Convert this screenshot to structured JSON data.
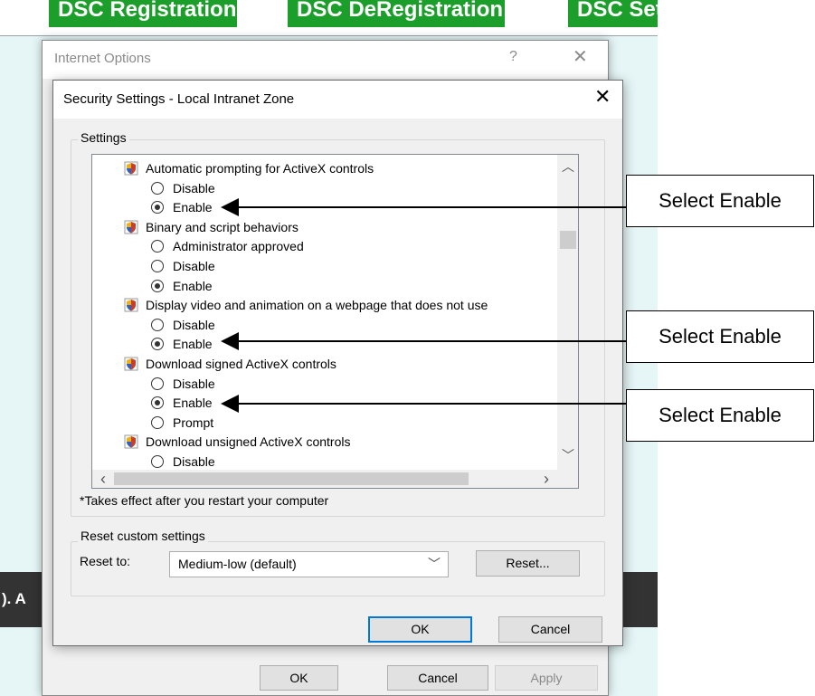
{
  "web_page": {
    "buttons": [
      "DSC Registration",
      "DSC DeRegistration",
      "DSC Set"
    ],
    "dark_bar_text": "). A"
  },
  "internet_options": {
    "title": "Internet Options",
    "help_glyph": "?",
    "close_glyph": "✕",
    "ok": "OK",
    "cancel": "Cancel",
    "apply": "Apply"
  },
  "dialog": {
    "title": "Security Settings - Local Intranet Zone",
    "close_glyph": "✕",
    "settings_group_label": "Settings",
    "settings": [
      {
        "kind": "category",
        "label": "Automatic prompting for ActiveX controls",
        "icon": "settings-shield-icon"
      },
      {
        "kind": "option",
        "label": "Disable",
        "checked": false
      },
      {
        "kind": "option",
        "label": "Enable",
        "checked": true
      },
      {
        "kind": "category",
        "label": "Binary and script behaviors",
        "icon": "settings-shield-icon"
      },
      {
        "kind": "option",
        "label": "Administrator approved",
        "checked": false
      },
      {
        "kind": "option",
        "label": "Disable",
        "checked": false
      },
      {
        "kind": "option",
        "label": "Enable",
        "checked": true
      },
      {
        "kind": "category",
        "label": "Display video and animation on a webpage that does not use",
        "icon": "settings-shield-icon"
      },
      {
        "kind": "option",
        "label": "Disable",
        "checked": false
      },
      {
        "kind": "option",
        "label": "Enable",
        "checked": true
      },
      {
        "kind": "category",
        "label": "Download signed ActiveX controls",
        "icon": "settings-shield-icon"
      },
      {
        "kind": "option",
        "label": "Disable",
        "checked": false
      },
      {
        "kind": "option",
        "label": "Enable",
        "checked": true
      },
      {
        "kind": "option",
        "label": "Prompt",
        "checked": false
      },
      {
        "kind": "category",
        "label": "Download unsigned ActiveX controls",
        "icon": "settings-shield-icon"
      },
      {
        "kind": "option",
        "label": "Disable",
        "checked": false
      }
    ],
    "scroll_up_glyph": "︿",
    "scroll_down_glyph": "﹀",
    "scroll_left_glyph": "‹",
    "scroll_right_glyph": "›",
    "restart_note": "*Takes effect after you restart your computer",
    "reset_group_label": "Reset custom settings",
    "reset_to_label": "Reset to:",
    "reset_to_value": "Medium-low (default)",
    "combo_arrow_glyph": "﹀",
    "reset_button": "Reset...",
    "ok": "OK",
    "cancel": "Cancel"
  },
  "annotations": [
    {
      "text": "Select Enable"
    },
    {
      "text": "Select Enable"
    },
    {
      "text": "Select Enable"
    }
  ],
  "colors": {
    "web_button_green": "#1c9e2a",
    "web_background": "#e6f6f7",
    "dialog_background": "#f0f0f0",
    "default_button_border": "#0078d7"
  }
}
